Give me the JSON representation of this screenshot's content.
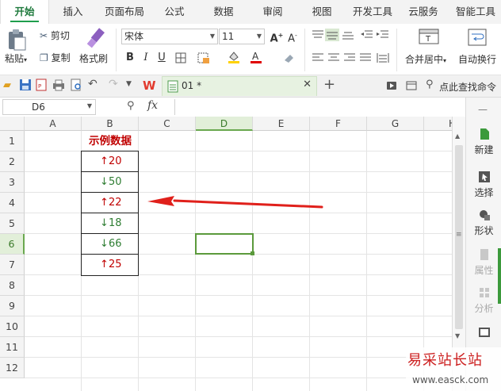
{
  "tabs": [
    "开始",
    "插入",
    "页面布局",
    "公式",
    "数据",
    "审阅",
    "视图",
    "开发工具",
    "云服务",
    "智能工具"
  ],
  "active_tab": "开始",
  "ribbon": {
    "paste": "粘贴",
    "cut": "剪切",
    "copy": "复制",
    "format_painter": "格式刷",
    "font_name": "宋体",
    "font_size": "11",
    "merge_center": "合并居中",
    "auto_wrap": "自动换行"
  },
  "quickbar": {
    "doc_name": "01 *",
    "search": "点此查找命令"
  },
  "formula_bar": {
    "name_box": "D6",
    "fx": "fx",
    "formula": ""
  },
  "columns": [
    "A",
    "B",
    "C",
    "D",
    "E",
    "F",
    "G",
    "H"
  ],
  "selected_column": "D",
  "rows": [
    "1",
    "2",
    "3",
    "4",
    "5",
    "6",
    "7",
    "8",
    "9",
    "10",
    "11",
    "12"
  ],
  "selected_row": "6",
  "selected_cell": "D6",
  "table": {
    "header": "示例数据",
    "items": [
      {
        "arrow": "↑",
        "value": "20",
        "dir": "up"
      },
      {
        "arrow": "↓",
        "value": "50",
        "dir": "down"
      },
      {
        "arrow": "↑",
        "value": "22",
        "dir": "up"
      },
      {
        "arrow": "↓",
        "value": "18",
        "dir": "down"
      },
      {
        "arrow": "↓",
        "value": "66",
        "dir": "down"
      },
      {
        "arrow": "↑",
        "value": "25",
        "dir": "up"
      }
    ]
  },
  "right_panel": {
    "new": "新建",
    "select": "选择",
    "shape": "形状",
    "properties": "属性",
    "analyze": "分析"
  },
  "watermark": {
    "cn": "易采站长站",
    "url": "www.easck.com"
  },
  "colors": {
    "accent_green": "#1f9e4d",
    "up_red": "#c00000",
    "down_green": "#2e7d32",
    "header_red": "#c00000",
    "annotation_arrow": "#e0201b"
  }
}
